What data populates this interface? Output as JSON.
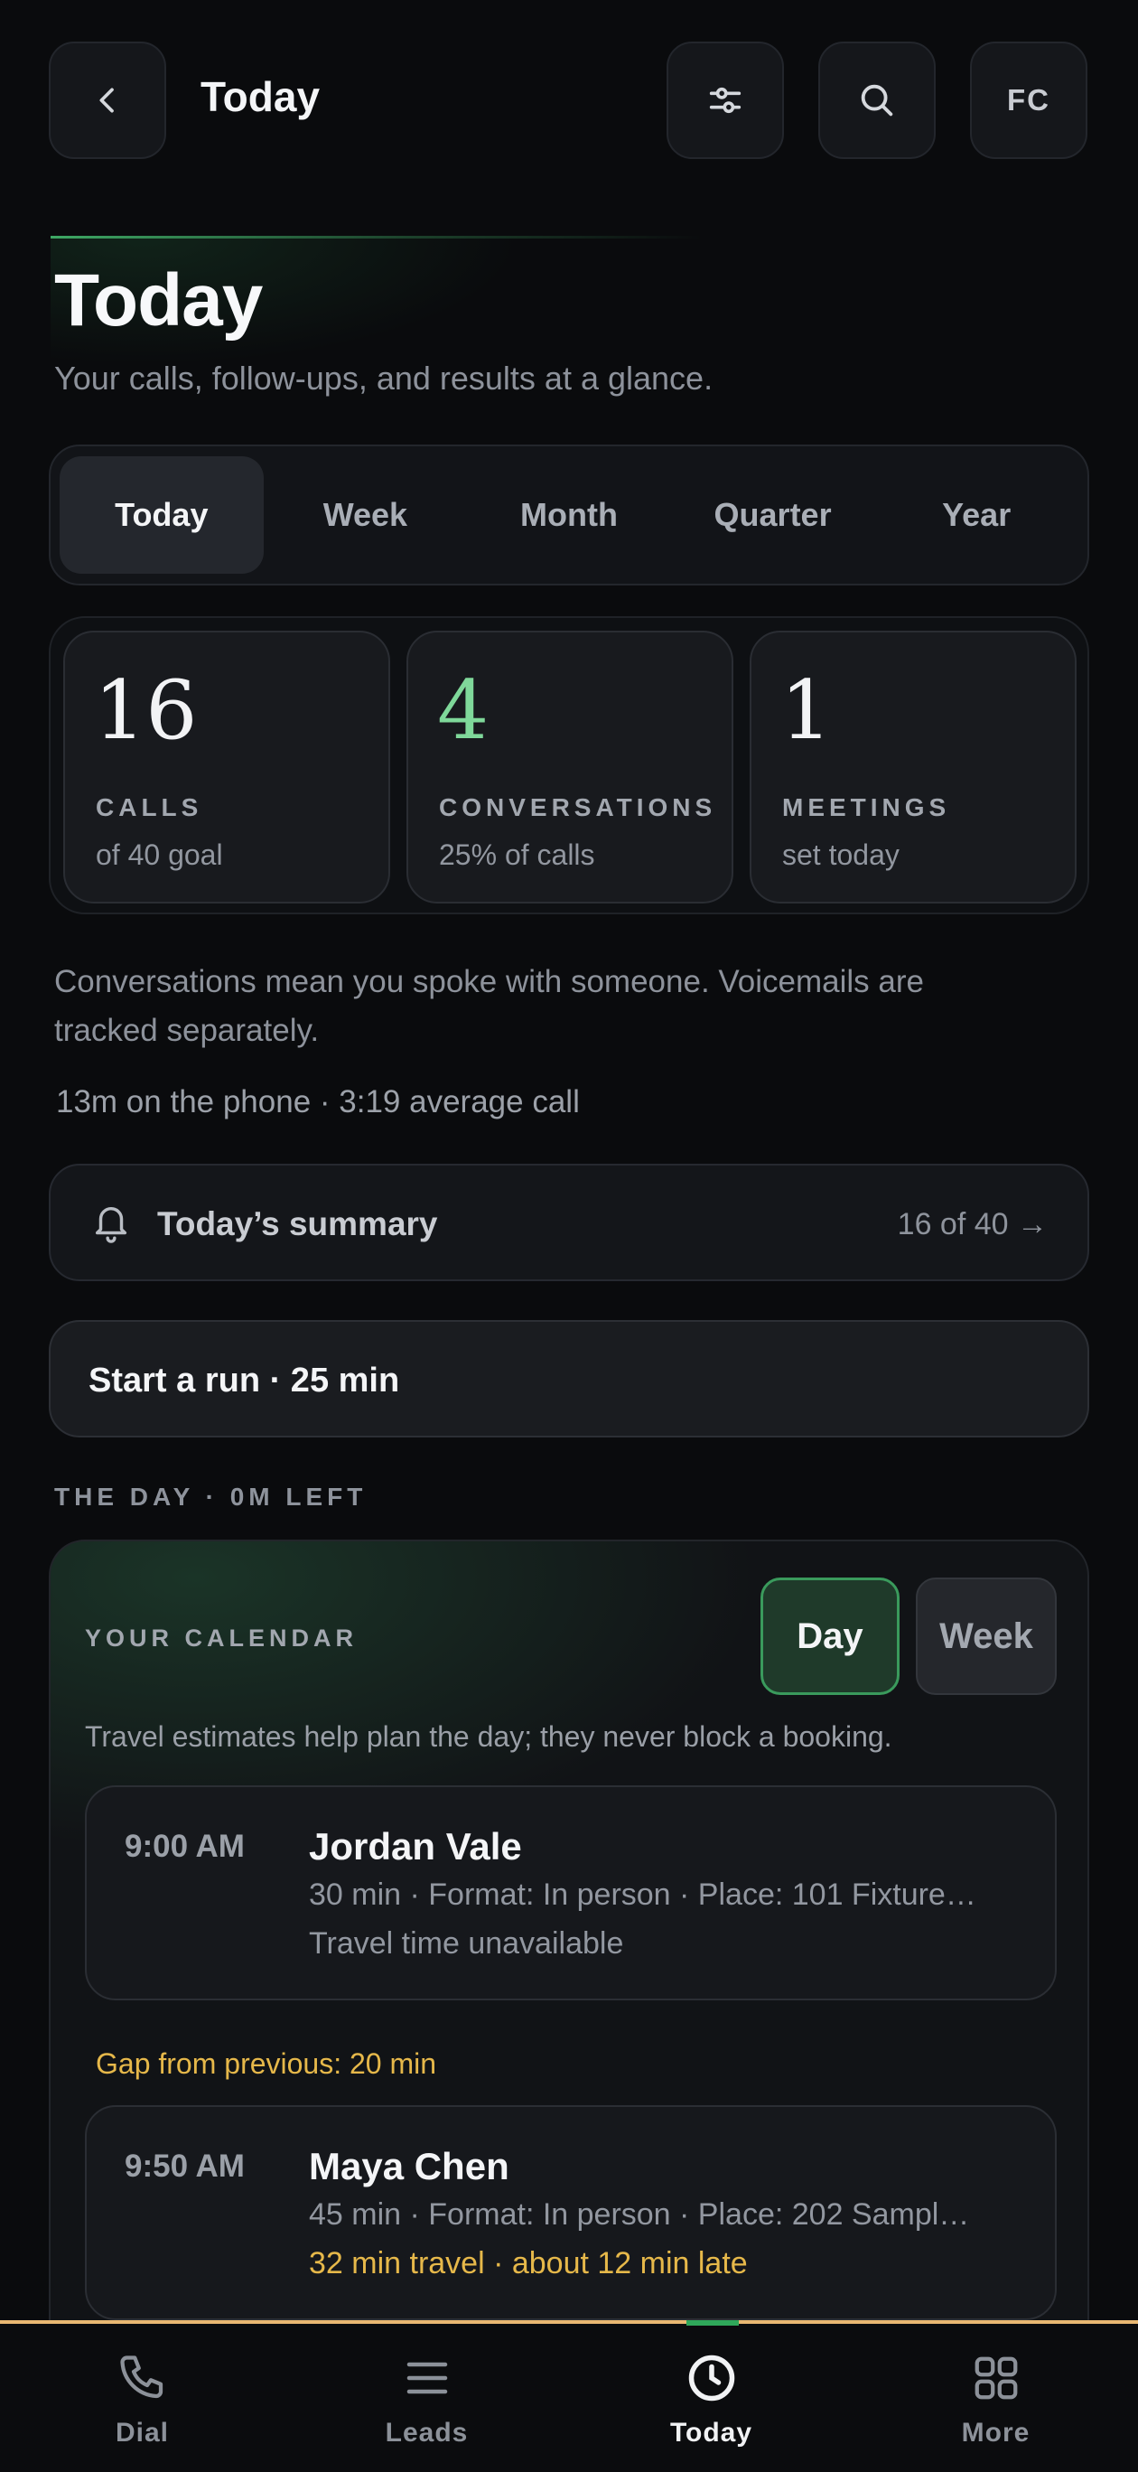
{
  "header": {
    "title": "Today",
    "avatar_initials": "FC",
    "icons": {
      "back": "chevron-left-icon",
      "filter": "sliders-icon",
      "search": "search-icon"
    }
  },
  "page": {
    "title": "Today",
    "subtitle": "Your calls, follow-ups, and results at a glance."
  },
  "tabs": [
    {
      "label": "Today",
      "active": true
    },
    {
      "label": "Week",
      "active": false
    },
    {
      "label": "Month",
      "active": false
    },
    {
      "label": "Quarter",
      "active": false
    },
    {
      "label": "Year",
      "active": false
    }
  ],
  "stats": [
    {
      "value": "16",
      "label": "CALLS",
      "sub": "of 40 goal"
    },
    {
      "value": "4",
      "label": "CONVERSATIONS",
      "sub": "25% of calls",
      "color": "#7fd89a"
    },
    {
      "value": "1",
      "label": "MEETINGS",
      "sub": "set today"
    }
  ],
  "note": "Conversations mean you spoke with someone. Voicemails are tracked separately.",
  "phone_line": "13m on the phone · 3:19 average call",
  "summary": {
    "title": "Today’s summary",
    "meta": "16 of 40 →",
    "icon": "bell-icon"
  },
  "run": {
    "label": "Start a run · 25 min"
  },
  "section_label": "THE DAY · 0M LEFT",
  "calendar": {
    "label": "YOUR CALENDAR",
    "view_day": "Day",
    "view_week": "Week",
    "active_view": "Day",
    "hint": "Travel estimates help plan the day; they never block a booking.",
    "appointments": [
      {
        "time": "9:00 AM",
        "name": "Jordan Vale",
        "meta": "30 min · Format: In person · Place: 101 Fixture…",
        "travel": "Travel time unavailable",
        "travel_warning": false
      },
      {
        "time": "9:50 AM",
        "name": "Maya Chen",
        "meta": "45 min · Format: In person · Place: 202 Sampl…",
        "travel": "32 min travel · about 12 min late",
        "travel_warning": true
      }
    ],
    "gap_text": "Gap from previous: 20 min"
  },
  "colors": {
    "accent_green": "#3ea864",
    "warning_amber": "#e6b84a",
    "nav_border": "#e9b872"
  },
  "nav": [
    {
      "label": "Dial",
      "icon": "phone-icon",
      "active": false
    },
    {
      "label": "Leads",
      "icon": "menu-icon",
      "active": false
    },
    {
      "label": "Today",
      "icon": "clock-icon",
      "active": true
    },
    {
      "label": "More",
      "icon": "grid-icon",
      "active": false
    }
  ]
}
